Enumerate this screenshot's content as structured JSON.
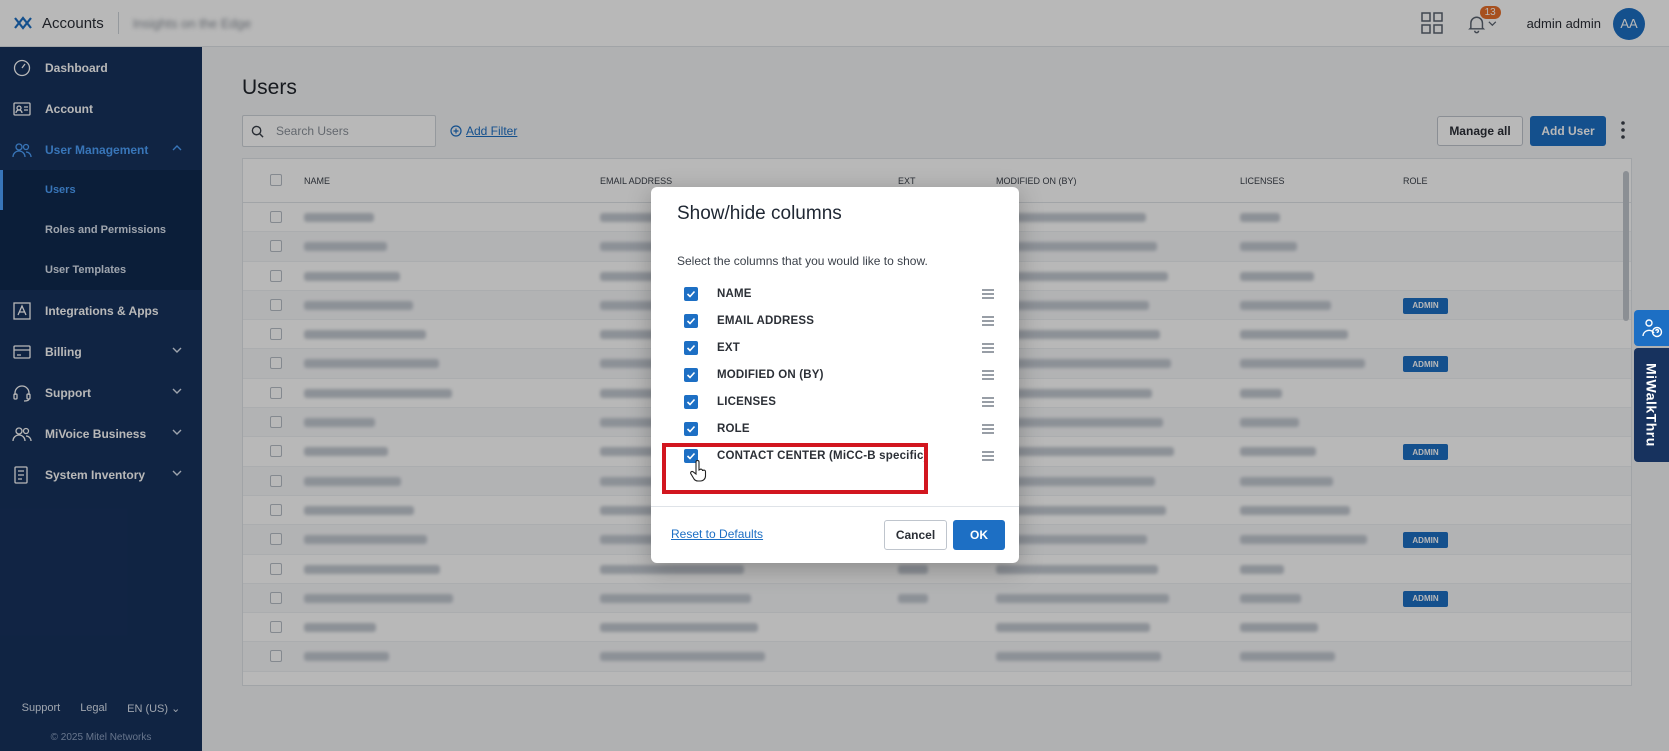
{
  "topbar": {
    "app_title": "Accounts",
    "org_name": "Insights on the Edge",
    "notification_count": "13",
    "user_name": "admin admin",
    "avatar_initials": "AA"
  },
  "sidebar": {
    "items": [
      {
        "label": "Dashboard",
        "icon": "dashboard-icon"
      },
      {
        "label": "Account",
        "icon": "account-card-icon"
      },
      {
        "label": "User Management",
        "icon": "users-icon"
      },
      {
        "label": "Integrations & Apps",
        "icon": "integrations-icon"
      },
      {
        "label": "Billing",
        "icon": "billing-icon"
      },
      {
        "label": "Support",
        "icon": "headset-icon"
      },
      {
        "label": "MiVoice Business",
        "icon": "users-icon"
      },
      {
        "label": "System Inventory",
        "icon": "inventory-icon"
      }
    ],
    "sub_items": [
      "Users",
      "Roles and Permissions",
      "User Templates"
    ],
    "footer": {
      "support": "Support",
      "legal": "Legal",
      "language": "EN (US)"
    },
    "copyright": "© 2025 Mitel Networks"
  },
  "main": {
    "title": "Users",
    "search_placeholder": "Search Users",
    "add_filter": "Add Filter",
    "manage_all": "Manage all",
    "add_user": "Add User"
  },
  "table": {
    "columns": [
      "NAME",
      "EMAIL ADDRESS",
      "EXT",
      "MODIFIED ON (BY)",
      "LICENSES",
      "ROLE"
    ],
    "admin_label": "ADMIN"
  },
  "modal": {
    "title": "Show/hide columns",
    "description": "Select the columns that you would like to show.",
    "options": [
      {
        "label": "NAME",
        "checked": true
      },
      {
        "label": "EMAIL ADDRESS",
        "checked": true
      },
      {
        "label": "EXT",
        "checked": true
      },
      {
        "label": "MODIFIED ON (BY)",
        "checked": true
      },
      {
        "label": "LICENSES",
        "checked": true
      },
      {
        "label": "ROLE",
        "checked": true
      },
      {
        "label": "CONTACT CENTER (MiCC-B specific)",
        "checked": true
      }
    ],
    "reset": "Reset to Defaults",
    "cancel": "Cancel",
    "ok": "OK"
  },
  "walkthru": {
    "label": "MiWalkThru"
  },
  "colors": {
    "primary": "#1d6fc4",
    "sidebar": "#17325e",
    "highlight": "#d2161f",
    "badge": "#e8702a"
  }
}
